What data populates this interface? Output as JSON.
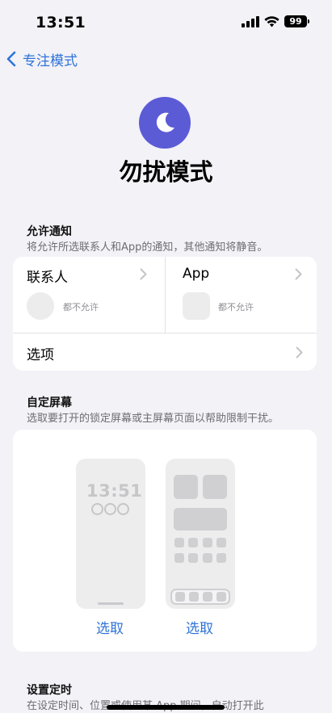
{
  "status_bar": {
    "time": "13:51",
    "battery": "99"
  },
  "nav": {
    "back_label": "专注模式"
  },
  "header": {
    "title": "勿扰模式",
    "icon": "moon-icon",
    "icon_color": "#5b5bd6"
  },
  "allowed_notifications": {
    "heading": "允许通知",
    "description": "将允许所选联系人和App的通知，其他通知将静音。",
    "people": {
      "label": "联系人",
      "status": "都不允许"
    },
    "apps": {
      "label": "App",
      "status": "都不允许"
    },
    "options_label": "选项"
  },
  "custom_screens": {
    "heading": "自定屏幕",
    "description": "选取要打开的锁定屏幕或主屏幕页面以帮助限制干扰。",
    "lock_screen_time": "13:51",
    "lock_screen_choose": "选取",
    "home_screen_choose": "选取"
  },
  "schedule": {
    "heading": "设置定时",
    "description": "在设定时间、位置或使用某 App 期间，自动打开此"
  },
  "colors": {
    "accent": "#2f73d9",
    "background": "#f2f2f7"
  }
}
